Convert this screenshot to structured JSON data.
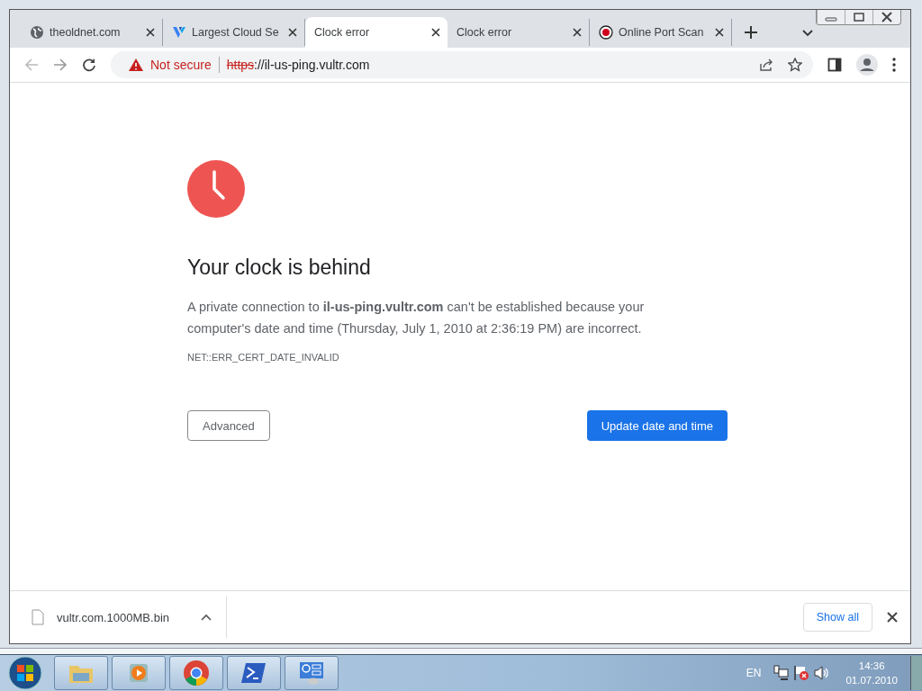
{
  "tabs": [
    {
      "title": "theoldnet.com",
      "kind": "globe",
      "selected": false
    },
    {
      "title": "Largest Cloud Se",
      "kind": "logo",
      "selected": false
    },
    {
      "title": "Clock error",
      "kind": "plain",
      "selected": true
    },
    {
      "title": "Clock error",
      "kind": "plain",
      "selected": false
    },
    {
      "title": "Online Port Scan",
      "kind": "target",
      "selected": false
    }
  ],
  "address_bar": {
    "security": "Not secure",
    "scheme": "https",
    "rest": "://il-us-ping.vultr.com"
  },
  "page": {
    "heading": "Your clock is behind",
    "message": "A private connection to **il-us-ping.vultr.com** can't be established because your computer's date and time (Thursday, July 1, 2010 at 2:36:19 PM) are incorrect.",
    "error_code": "NET::ERR_CERT_DATE_INVALID",
    "buttons": [
      {
        "label": "Advanced",
        "kind": "secondary"
      },
      {
        "label": "Update date and time",
        "kind": "primary"
      }
    ]
  },
  "download_bar": {
    "file": "vultr.com.1000MB.bin",
    "show_all": "Show all"
  },
  "taskbar": {
    "apps": [
      {
        "kind": "folder"
      },
      {
        "kind": "media"
      },
      {
        "kind": "browser"
      },
      {
        "kind": "shell"
      },
      {
        "kind": "panel"
      }
    ],
    "tray": {
      "language": "EN",
      "time": "14:36",
      "date": "01.07.2010"
    }
  }
}
